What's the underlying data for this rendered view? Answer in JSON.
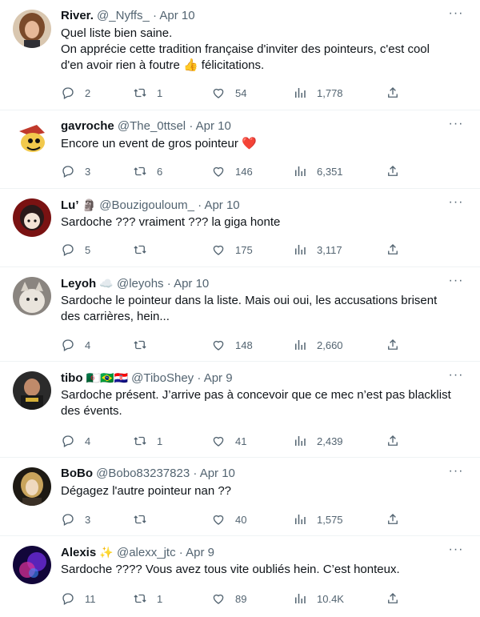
{
  "tweets": [
    {
      "name": "River.",
      "badge": "",
      "handle": "@_Nyffs_",
      "date": "Apr 10",
      "text_line1": "Quel liste bien saine.",
      "text_line2": "On apprécie cette tradition française d'inviter des pointeurs, c'est cool",
      "text_line3_a": "d'en avoir rien à foutre ",
      "text_emoji": "👍",
      "text_line3_b": " félicitations.",
      "replies": "2",
      "retweets": "1",
      "likes": "54",
      "views": "1,778"
    },
    {
      "name": "gavroche",
      "handle": "@The_0ttsel",
      "date": "Apr 10",
      "text": "Encore un event de gros pointeur ",
      "text_emoji": "❤️",
      "replies": "3",
      "retweets": "6",
      "likes": "146",
      "views": "6,351"
    },
    {
      "name": "Lu’",
      "badge": "🗿",
      "handle": "@Bouzigouloum_",
      "date": "Apr 10",
      "text": "Sardoche ??? vraiment ??? la giga honte",
      "replies": "5",
      "retweets": "",
      "likes": "175",
      "views": "3,117"
    },
    {
      "name": "Leyoh",
      "badge": "☁️",
      "handle": "@leyohs",
      "date": "Apr 10",
      "text": "Sardoche le pointeur dans la liste. Mais oui oui, les accusations brisent\ndes carrières, hein...",
      "replies": "4",
      "retweets": "",
      "likes": "148",
      "views": "2,660"
    },
    {
      "name": "tibo",
      "badge": "🇩🇿🇧🇷🇭🇷",
      "handle": "@TiboShey",
      "date": "Apr 9",
      "text": "Sardoche présent. J’arrive pas à concevoir que ce mec n’est pas blacklist\ndes évents.",
      "replies": "4",
      "retweets": "1",
      "likes": "41",
      "views": "2,439"
    },
    {
      "name": "BoBo",
      "handle": "@Bobo83237823",
      "date": "Apr 10",
      "text": "Dégagez l'autre pointeur nan ??",
      "replies": "3",
      "retweets": "",
      "likes": "40",
      "views": "1,575"
    },
    {
      "name": "Alexis",
      "badge": "✨",
      "handle": "@alexx_jtc",
      "date": "Apr 9",
      "text": "Sardoche ???? Vous avez tous vite oubliés hein. C’est honteux.",
      "replies": "11",
      "retweets": "1",
      "likes": "89",
      "views": "10.4K"
    }
  ],
  "ui": {
    "dot": "·",
    "more": "···"
  },
  "colors": {
    "secondary": "#536471",
    "text": "#0f1419",
    "border": "#eff3f4"
  },
  "icons": [
    "reply-icon",
    "retweet-icon",
    "like-icon",
    "views-icon",
    "share-icon",
    "more-icon"
  ]
}
